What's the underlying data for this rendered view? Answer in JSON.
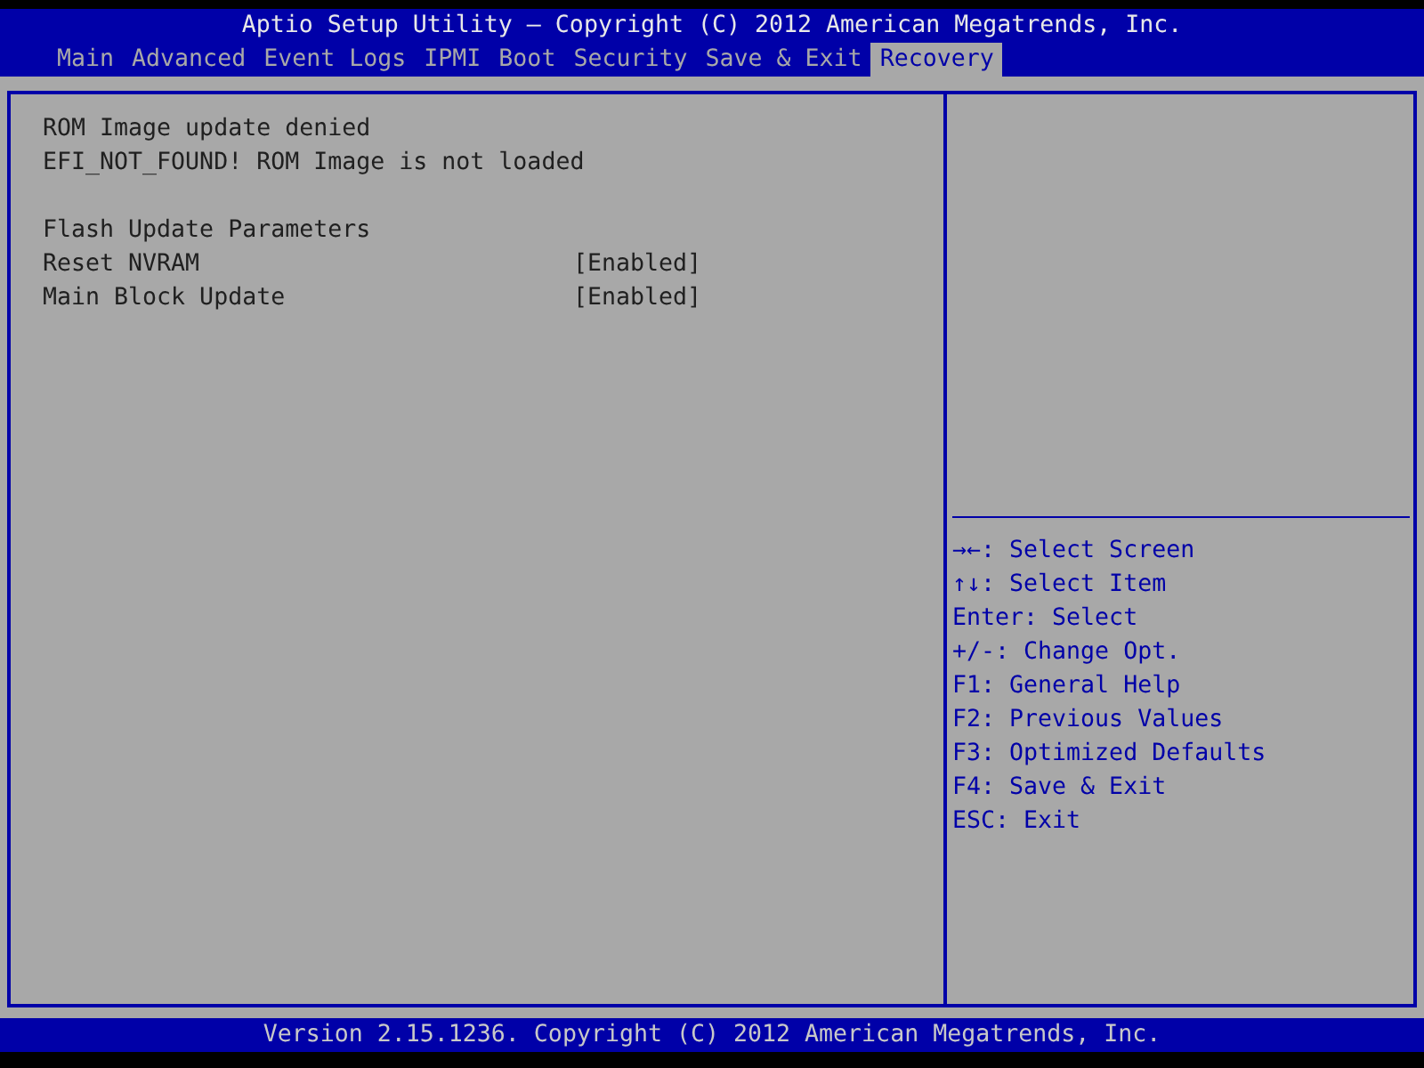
{
  "header": {
    "title": "Aptio Setup Utility – Copyright (C) 2012 American Megatrends, Inc."
  },
  "tabs": [
    {
      "label": "Main",
      "selected": false
    },
    {
      "label": "Advanced",
      "selected": false
    },
    {
      "label": "Event Logs",
      "selected": false
    },
    {
      "label": "IPMI",
      "selected": false
    },
    {
      "label": "Boot",
      "selected": false
    },
    {
      "label": "Security",
      "selected": false
    },
    {
      "label": "Save & Exit",
      "selected": false
    },
    {
      "label": "Recovery",
      "selected": true
    }
  ],
  "items": [
    {
      "kind": "text",
      "label": "ROM Image update denied"
    },
    {
      "kind": "text",
      "label": "EFI_NOT_FOUND! ROM Image is not loaded"
    },
    {
      "kind": "blank"
    },
    {
      "kind": "text",
      "label": "Flash Update Parameters"
    },
    {
      "kind": "setting",
      "label": "Reset NVRAM",
      "value": "[Enabled]"
    },
    {
      "kind": "setting",
      "label": "Main Block Update",
      "value": "[Enabled]"
    }
  ],
  "help_keys": [
    "→←: Select Screen",
    "↑↓: Select Item",
    "Enter: Select",
    "+/-: Change Opt.",
    "F1: General Help",
    "F2: Previous Values",
    "F3: Optimized Defaults",
    "F4: Save & Exit",
    "ESC: Exit"
  ],
  "footer": {
    "text": "Version 2.15.1236. Copyright (C) 2012 American Megatrends, Inc."
  }
}
